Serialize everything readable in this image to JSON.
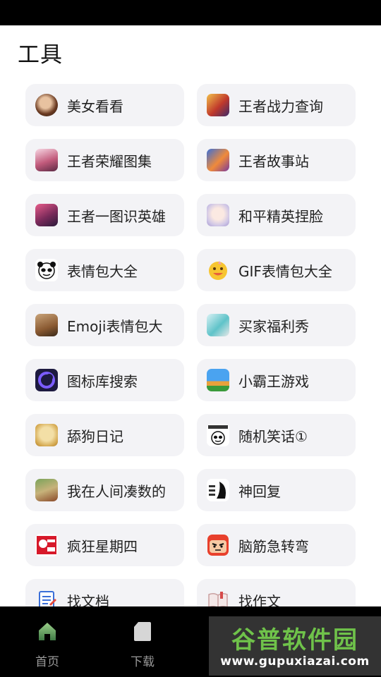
{
  "section_title": "工具",
  "tools": [
    {
      "label": "美女看看",
      "icon": "portrait-icon"
    },
    {
      "label": "王者战力查询",
      "icon": "hero-portrait-icon"
    },
    {
      "label": "王者荣耀图集",
      "icon": "gallery-icon"
    },
    {
      "label": "王者故事站",
      "icon": "story-icon"
    },
    {
      "label": "王者一图识英雄",
      "icon": "hero-quiz-icon"
    },
    {
      "label": "和平精英捏脸",
      "icon": "face-edit-icon"
    },
    {
      "label": "表情包大全",
      "icon": "panda-meme-icon"
    },
    {
      "label": "GIF表情包大全",
      "icon": "gif-emoji-icon"
    },
    {
      "label": "Emoji表情包大",
      "icon": "emoji-cat-icon"
    },
    {
      "label": "买家福利秀",
      "icon": "buyer-show-icon"
    },
    {
      "label": "图标库搜索",
      "icon": "icon-search-icon"
    },
    {
      "label": "小霸王游戏",
      "icon": "retro-game-icon"
    },
    {
      "label": "舔狗日记",
      "icon": "doge-icon"
    },
    {
      "label": "随机笑话①",
      "icon": "joke-panda-icon"
    },
    {
      "label": "我在人间凑数的",
      "icon": "landscape-icon"
    },
    {
      "label": "神回复",
      "icon": "reply-meme-icon"
    },
    {
      "label": "疯狂星期四",
      "icon": "kfc-icon"
    },
    {
      "label": "脑筋急转弯",
      "icon": "brain-teaser-icon"
    },
    {
      "label": "找文档",
      "icon": "document-icon"
    },
    {
      "label": "找作文",
      "icon": "essay-book-icon"
    }
  ],
  "tabbar": {
    "home_label": "首页",
    "download_label": "下载"
  },
  "watermark": {
    "name": "谷普软件园",
    "url": "www.gupuxiazai.com"
  }
}
